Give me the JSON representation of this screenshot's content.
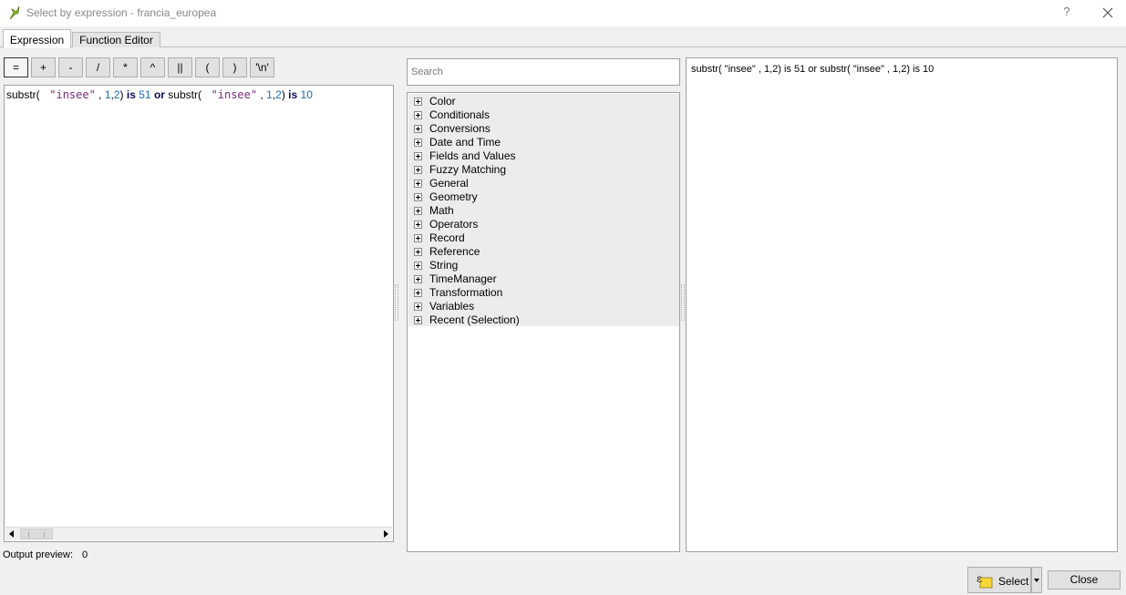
{
  "window": {
    "title": "Select by expression - francia_europea",
    "help_label": "?"
  },
  "tabs": [
    {
      "label": "Expression",
      "active": true
    },
    {
      "label": "Function Editor",
      "active": false
    }
  ],
  "operators": [
    "=",
    "+",
    "-",
    "/",
    "*",
    "^",
    "||",
    "(",
    ")",
    "'\\n'"
  ],
  "expression": {
    "parts": [
      {
        "text": "substr( ",
        "kind": "fn"
      },
      {
        "text": " \"insee\"",
        "kind": "str"
      },
      {
        "text": " , ",
        "kind": "fn"
      },
      {
        "text": "1",
        "kind": "num"
      },
      {
        "text": ",",
        "kind": "fn"
      },
      {
        "text": "2",
        "kind": "num"
      },
      {
        "text": ") ",
        "kind": "fn"
      },
      {
        "text": "is",
        "kind": "kw"
      },
      {
        "text": " ",
        "kind": "fn"
      },
      {
        "text": "51",
        "kind": "num"
      },
      {
        "text": " ",
        "kind": "fn"
      },
      {
        "text": "or",
        "kind": "kw"
      },
      {
        "text": " substr( ",
        "kind": "fn"
      },
      {
        "text": " \"insee\"",
        "kind": "str"
      },
      {
        "text": " , ",
        "kind": "fn"
      },
      {
        "text": "1",
        "kind": "num"
      },
      {
        "text": ",",
        "kind": "fn"
      },
      {
        "text": "2",
        "kind": "num"
      },
      {
        "text": ") ",
        "kind": "fn"
      },
      {
        "text": "is",
        "kind": "kw"
      },
      {
        "text": " ",
        "kind": "fn"
      },
      {
        "text": "10",
        "kind": "num"
      }
    ]
  },
  "output_preview": {
    "label": "Output preview:",
    "value": "0"
  },
  "search": {
    "placeholder": "Search",
    "value": ""
  },
  "function_groups": [
    "Color",
    "Conditionals",
    "Conversions",
    "Date and Time",
    "Fields and Values",
    "Fuzzy Matching",
    "General",
    "Geometry",
    "Math",
    "Operators",
    "Record",
    "Reference",
    "String",
    "TimeManager",
    "Transformation",
    "Variables",
    "Recent (Selection)"
  ],
  "help_panel": {
    "text": "substr( \"insee\" , 1,2) is 51 or substr( \"insee\" , 1,2) is 10"
  },
  "buttons": {
    "select_label": "Select",
    "close_label": "Close"
  },
  "colors": {
    "string": "#7a2c7a",
    "number": "#1a6fb0",
    "keyword": "#0b0b5a"
  }
}
